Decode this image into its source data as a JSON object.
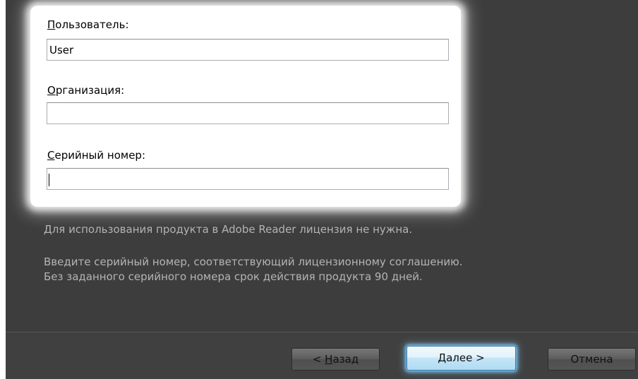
{
  "form": {
    "user_label_accel": "П",
    "user_label_rest": "ользователь:",
    "user_value": "User",
    "org_label_accel": "О",
    "org_label_rest": "рганизация:",
    "org_value": "",
    "serial_label_accel": "С",
    "serial_label_rest": "ерийный номер:",
    "serial_value": ""
  },
  "info": {
    "line1": "Для использования продукта в Adobe Reader лицензия не нужна.",
    "line2": "Введите серийный номер, соответствующий лицензионному соглашению.",
    "line3": "Без заданного серийного номера срок действия продукта 90 дней."
  },
  "buttons": {
    "back_prefix": "< ",
    "back_accel": "Н",
    "back_rest": "азад",
    "next_accel": "Д",
    "next_rest": "алее >",
    "cancel_label": "Отмена"
  },
  "colors": {
    "dialog_bg": "#3d3d3d",
    "highlight": "#ffffff",
    "default_button": "#c4e5f6"
  }
}
